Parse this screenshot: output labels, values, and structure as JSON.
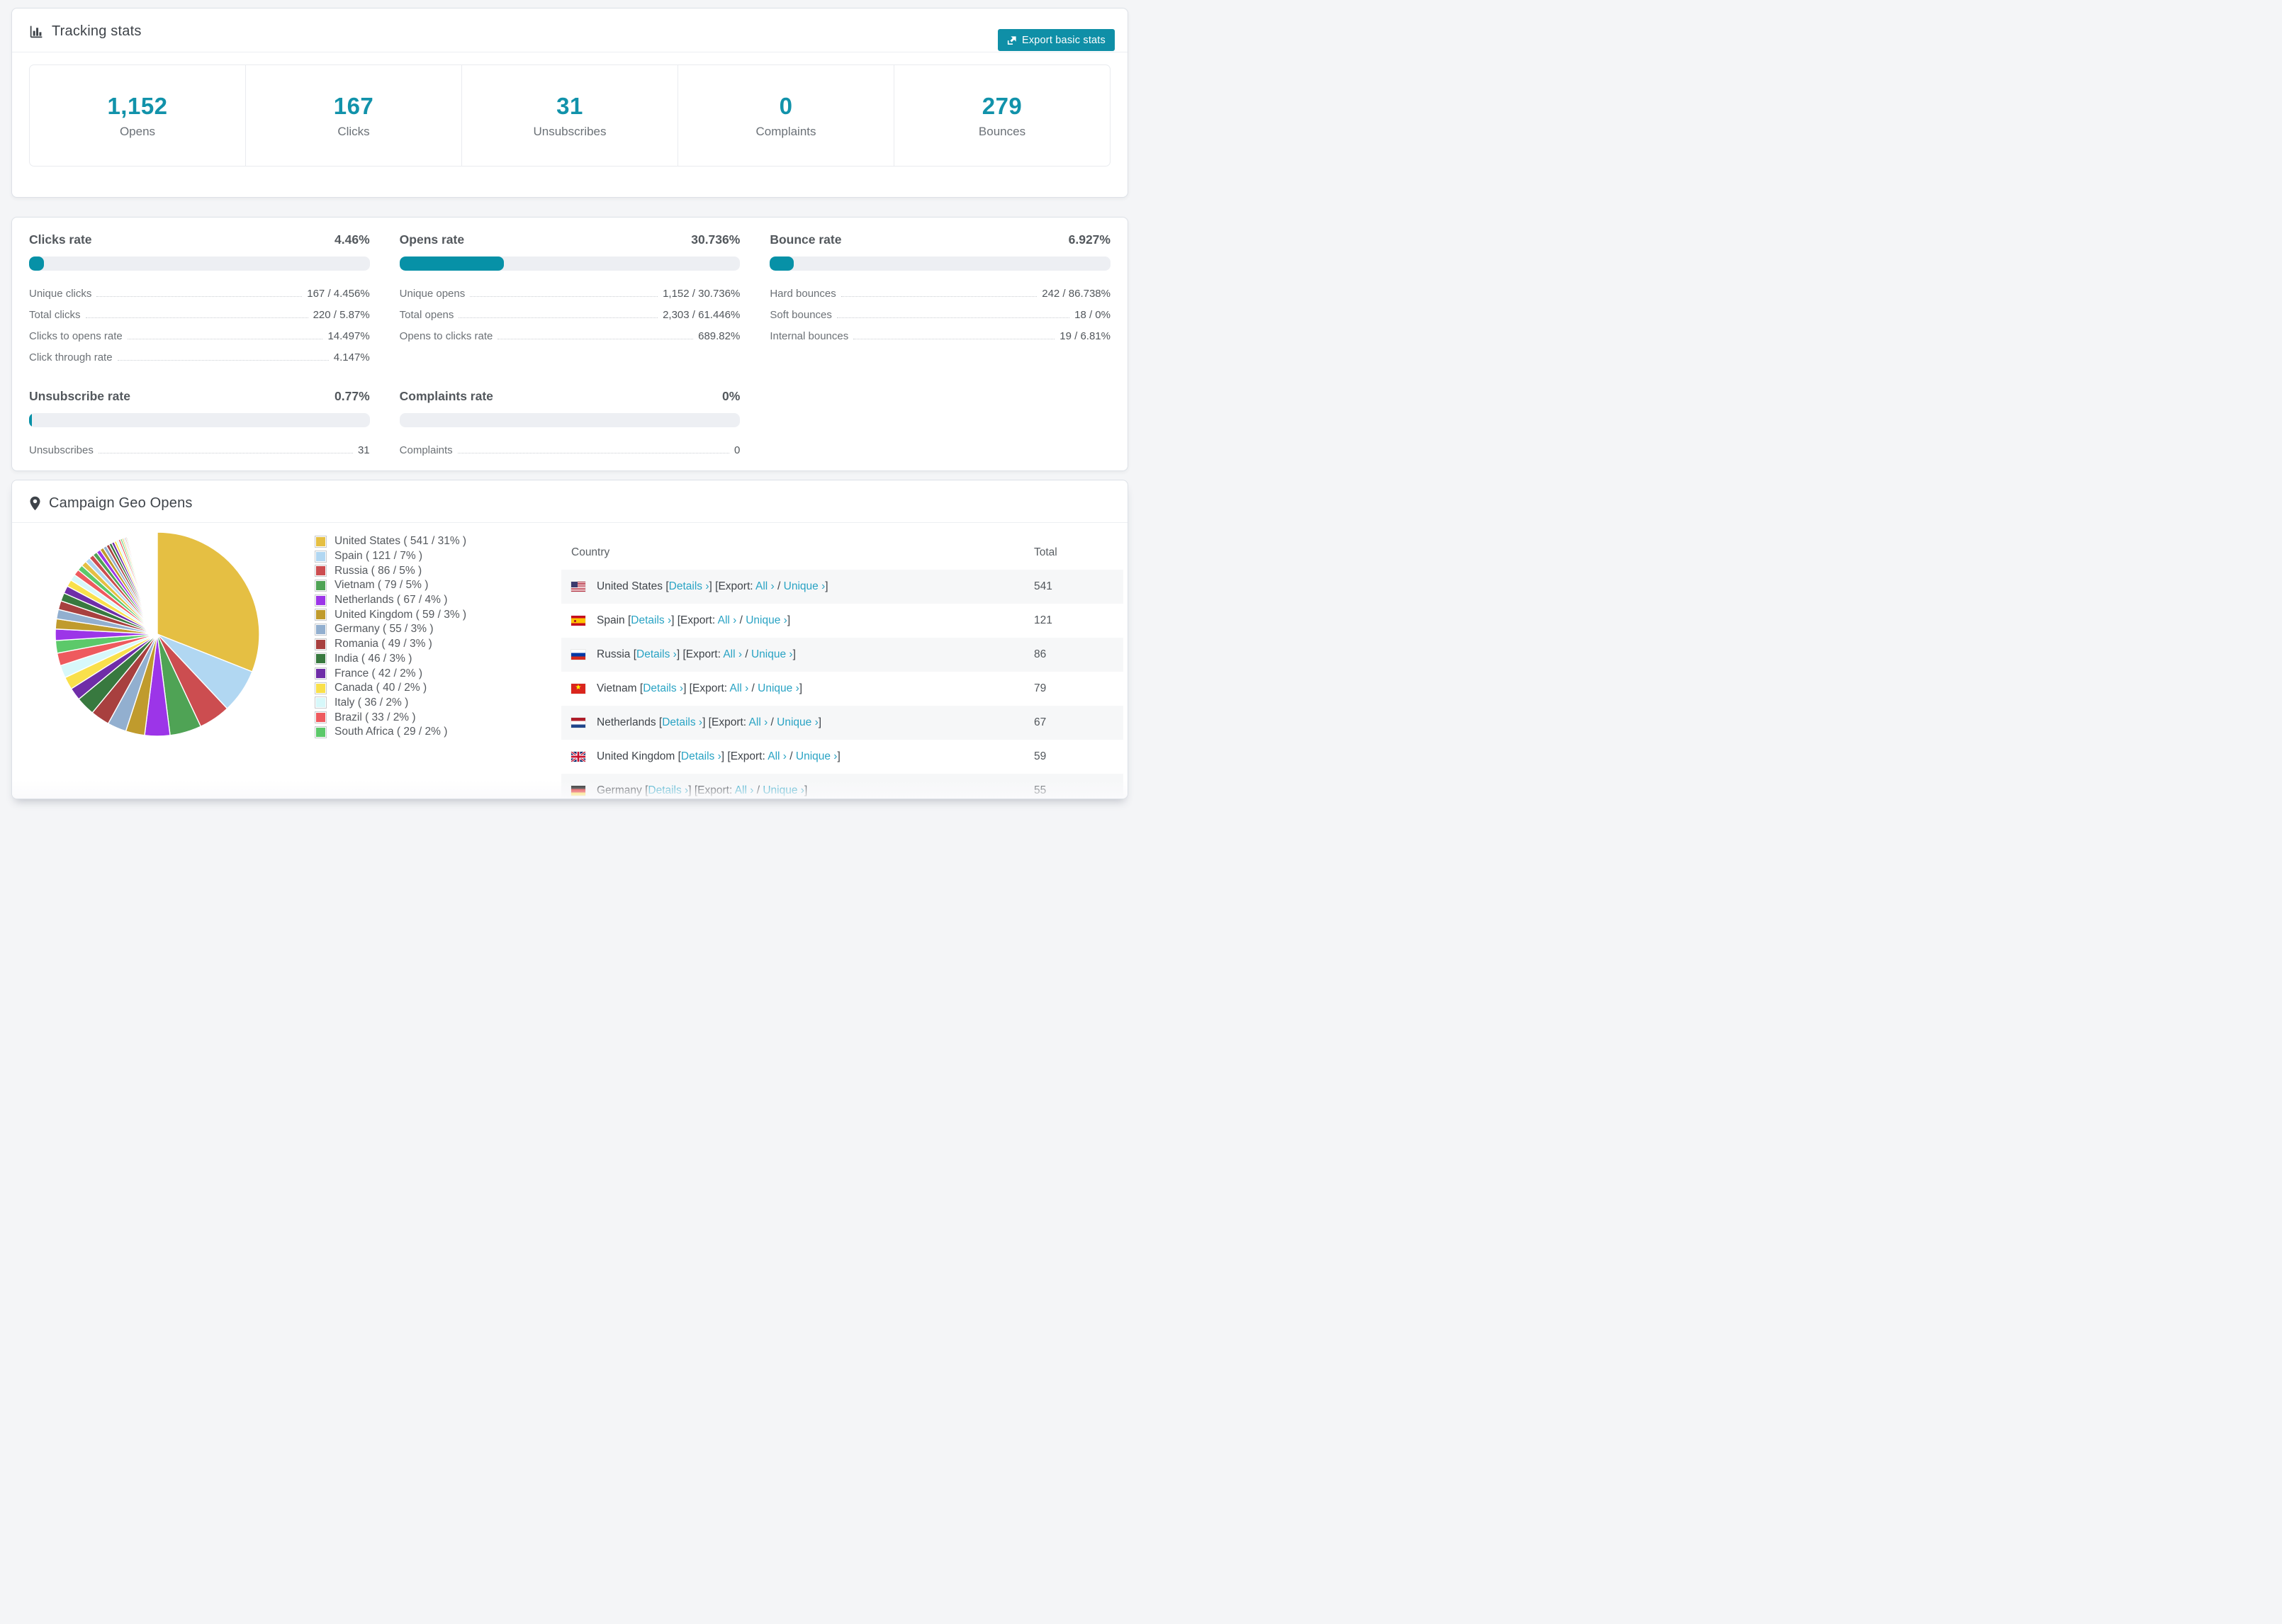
{
  "tracking": {
    "title": "Tracking stats",
    "export_label": "Export basic stats"
  },
  "stats": [
    {
      "value": "1,152",
      "label": "Opens"
    },
    {
      "value": "167",
      "label": "Clicks"
    },
    {
      "value": "31",
      "label": "Unsubscribes"
    },
    {
      "value": "0",
      "label": "Complaints"
    },
    {
      "value": "279",
      "label": "Bounces"
    }
  ],
  "rates": [
    {
      "title": "Clicks rate",
      "value": "4.46%",
      "fill_pct": 4.46,
      "rows": [
        {
          "label": "Unique clicks",
          "value": "167 / 4.456%"
        },
        {
          "label": "Total clicks",
          "value": "220 / 5.87%"
        },
        {
          "label": "Clicks to opens rate",
          "value": "14.497%"
        },
        {
          "label": "Click through rate",
          "value": "4.147%"
        }
      ]
    },
    {
      "title": "Opens rate",
      "value": "30.736%",
      "fill_pct": 30.736,
      "rows": [
        {
          "label": "Unique opens",
          "value": "1,152 / 30.736%"
        },
        {
          "label": "Total opens",
          "value": "2,303 / 61.446%"
        },
        {
          "label": "Opens to clicks rate",
          "value": "689.82%"
        }
      ]
    },
    {
      "title": "Bounce rate",
      "value": "6.927%",
      "fill_pct": 6.927,
      "rows": [
        {
          "label": "Hard bounces",
          "value": "242 / 86.738%"
        },
        {
          "label": "Soft bounces",
          "value": "18 / 0%"
        },
        {
          "label": "Internal bounces",
          "value": "19 / 6.81%"
        }
      ]
    },
    {
      "title": "Unsubscribe rate",
      "value": "0.77%",
      "fill_pct": 0.77,
      "rows": [
        {
          "label": "Unsubscribes",
          "value": "31"
        }
      ]
    },
    {
      "title": "Complaints rate",
      "value": "0%",
      "fill_pct": 0,
      "rows": [
        {
          "label": "Complaints",
          "value": "0"
        }
      ]
    }
  ],
  "geo": {
    "title": "Campaign Geo Opens",
    "legend": [
      {
        "label": "United States ( 541 / 31% )",
        "color": "#e5bf43"
      },
      {
        "label": "Spain ( 121 / 7% )",
        "color": "#b1d7f2"
      },
      {
        "label": "Russia ( 86 / 5% )",
        "color": "#cc4d50"
      },
      {
        "label": "Vietnam ( 79 / 5% )",
        "color": "#4fa355"
      },
      {
        "label": "Netherlands ( 67 / 4% )",
        "color": "#9c35e8"
      },
      {
        "label": "United Kingdom ( 59 / 3% )",
        "color": "#c09b2d"
      },
      {
        "label": "Germany ( 55 / 3% )",
        "color": "#92afcf"
      },
      {
        "label": "Romania ( 49 / 3% )",
        "color": "#a8403f"
      },
      {
        "label": "India ( 46 / 3% )",
        "color": "#38793f"
      },
      {
        "label": "France ( 42 / 2% )",
        "color": "#6f2da8"
      },
      {
        "label": "Canada ( 40 / 2% )",
        "color": "#f9e04b"
      },
      {
        "label": "Italy ( 36 / 2% )",
        "color": "#d7f8fa"
      },
      {
        "label": "Brazil ( 33 / 2% )",
        "color": "#ee5a5e"
      },
      {
        "label": "South Africa ( 29 / 2% )",
        "color": "#5cc96a"
      }
    ],
    "table": {
      "columns": {
        "country": "Country",
        "total": "Total"
      },
      "link_labels": {
        "details": "Details ›",
        "export": "Export:",
        "all": "All ›",
        "unique": "Unique ›",
        "slash": "/"
      },
      "rows": [
        {
          "country": "United States",
          "flag": "us",
          "total": "541"
        },
        {
          "country": "Spain",
          "flag": "spain",
          "total": "121"
        },
        {
          "country": "Russia",
          "flag": "russia",
          "total": "86"
        },
        {
          "country": "Vietnam",
          "flag": "vietnam",
          "total": "79"
        },
        {
          "country": "Netherlands",
          "flag": "netherlands",
          "total": "67"
        },
        {
          "country": "United Kingdom",
          "flag": "uk",
          "total": "59"
        },
        {
          "country": "Germany",
          "flag": "germany",
          "total": "55",
          "clipped": true
        }
      ]
    }
  },
  "chart_data": {
    "type": "pie",
    "title": "Campaign Geo Opens",
    "unit": "opens",
    "legend_position": "right",
    "start_angle_deg": 0,
    "direction": "clockwise",
    "slices": [
      {
        "label": "United States",
        "value": 541,
        "pct": 31,
        "color": "#e5bf43"
      },
      {
        "label": "Spain",
        "value": 121,
        "pct": 7,
        "color": "#b1d7f2"
      },
      {
        "label": "Russia",
        "value": 86,
        "pct": 5,
        "color": "#cc4d50"
      },
      {
        "label": "Vietnam",
        "value": 79,
        "pct": 5,
        "color": "#4fa355"
      },
      {
        "label": "Netherlands",
        "value": 67,
        "pct": 4,
        "color": "#9c35e8"
      },
      {
        "label": "United Kingdom",
        "value": 59,
        "pct": 3,
        "color": "#c09b2d"
      },
      {
        "label": "Germany",
        "value": 55,
        "pct": 3,
        "color": "#92afcf"
      },
      {
        "label": "Romania",
        "value": 49,
        "pct": 3,
        "color": "#a8403f"
      },
      {
        "label": "India",
        "value": 46,
        "pct": 3,
        "color": "#38793f"
      },
      {
        "label": "France",
        "value": 42,
        "pct": 2,
        "color": "#6f2da8"
      },
      {
        "label": "Canada",
        "value": 40,
        "pct": 2,
        "color": "#f9e04b"
      },
      {
        "label": "Italy",
        "value": 36,
        "pct": 2,
        "color": "#d7f8fa"
      },
      {
        "label": "Brazil",
        "value": 33,
        "pct": 2,
        "color": "#ee5a5e"
      },
      {
        "label": "South Africa",
        "value": 29,
        "pct": 2,
        "color": "#5cc96a"
      }
    ],
    "others": {
      "note": "long tail of small countries rendered as progressively thinner slices",
      "palette_start_index": 4,
      "pct_values": [
        1.8,
        1.6,
        1.5,
        1.4,
        1.3,
        1.2,
        1.1,
        1.0,
        0.95,
        0.9,
        0.85,
        0.8,
        0.75,
        0.7,
        0.65,
        0.6,
        0.55,
        0.5,
        0.45,
        0.42,
        0.38,
        0.35,
        0.32,
        0.28,
        0.25,
        0.22,
        0.2,
        0.18,
        0.15,
        0.13,
        0.11,
        0.1,
        0.08,
        0.07,
        0.06,
        0.05,
        0.04,
        0.03,
        0.02,
        0.02
      ]
    }
  }
}
